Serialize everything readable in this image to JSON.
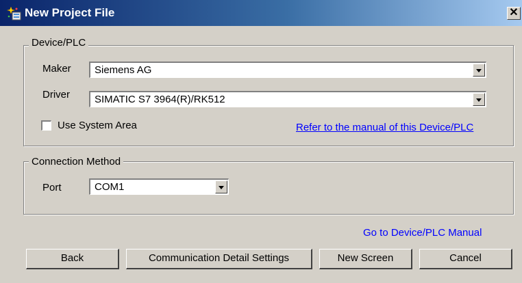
{
  "window": {
    "title": "New Project File",
    "close_glyph": "✕"
  },
  "device_plc": {
    "legend": "Device/PLC",
    "maker_label": "Maker",
    "maker_value": "Siemens AG",
    "driver_label": "Driver",
    "driver_value": "SIMATIC S7 3964(R)/RK512",
    "use_system_area_label": "Use System Area",
    "use_system_area_checked": false,
    "manual_link": "Refer to the manual of this Device/PLC"
  },
  "connection_method": {
    "legend": "Connection Method",
    "port_label": "Port",
    "port_value": "COM1"
  },
  "plc_manual_link": "Go to Device/PLC Manual",
  "buttons": {
    "back": "Back",
    "comm_settings": "Communication Detail Settings",
    "new_screen": "New Screen",
    "cancel": "Cancel"
  },
  "colors": {
    "title_bar_start": "#0a246a",
    "title_bar_end": "#a6caf0",
    "dialog_face": "#d4d0c8",
    "link": "#0000ff"
  },
  "icons": {
    "title": "project-sparkle-icon",
    "dropdown": "dropdown-arrow-icon"
  }
}
